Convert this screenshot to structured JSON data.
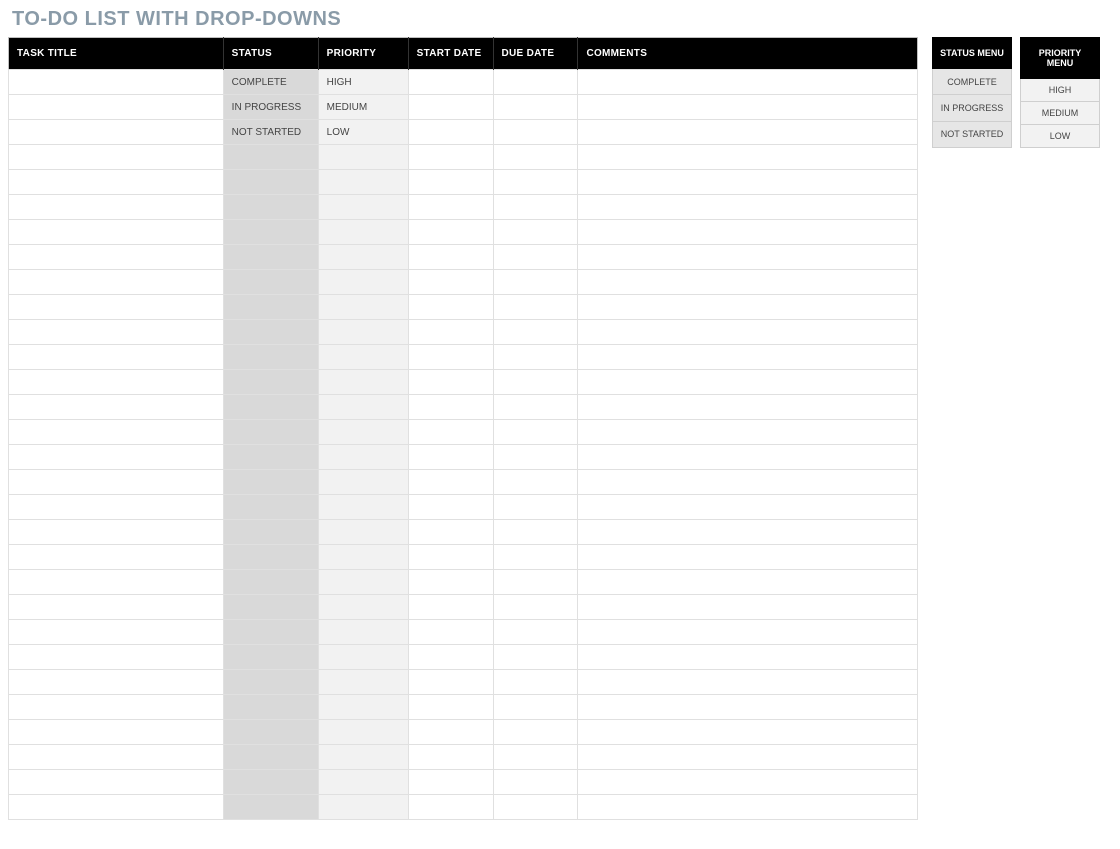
{
  "title": "TO-DO LIST WITH DROP-DOWNS",
  "columns": {
    "task": "TASK TITLE",
    "status": "STATUS",
    "priority": "PRIORITY",
    "start": "START DATE",
    "due": "DUE DATE",
    "comments": "COMMENTS"
  },
  "rows": [
    {
      "task": "",
      "status": "COMPLETE",
      "priority": "HIGH",
      "start": "",
      "due": "",
      "comments": ""
    },
    {
      "task": "",
      "status": "IN PROGRESS",
      "priority": "MEDIUM",
      "start": "",
      "due": "",
      "comments": ""
    },
    {
      "task": "",
      "status": "NOT STARTED",
      "priority": "LOW",
      "start": "",
      "due": "",
      "comments": ""
    },
    {
      "task": "",
      "status": "",
      "priority": "",
      "start": "",
      "due": "",
      "comments": ""
    },
    {
      "task": "",
      "status": "",
      "priority": "",
      "start": "",
      "due": "",
      "comments": ""
    },
    {
      "task": "",
      "status": "",
      "priority": "",
      "start": "",
      "due": "",
      "comments": ""
    },
    {
      "task": "",
      "status": "",
      "priority": "",
      "start": "",
      "due": "",
      "comments": ""
    },
    {
      "task": "",
      "status": "",
      "priority": "",
      "start": "",
      "due": "",
      "comments": ""
    },
    {
      "task": "",
      "status": "",
      "priority": "",
      "start": "",
      "due": "",
      "comments": ""
    },
    {
      "task": "",
      "status": "",
      "priority": "",
      "start": "",
      "due": "",
      "comments": ""
    },
    {
      "task": "",
      "status": "",
      "priority": "",
      "start": "",
      "due": "",
      "comments": ""
    },
    {
      "task": "",
      "status": "",
      "priority": "",
      "start": "",
      "due": "",
      "comments": ""
    },
    {
      "task": "",
      "status": "",
      "priority": "",
      "start": "",
      "due": "",
      "comments": ""
    },
    {
      "task": "",
      "status": "",
      "priority": "",
      "start": "",
      "due": "",
      "comments": ""
    },
    {
      "task": "",
      "status": "",
      "priority": "",
      "start": "",
      "due": "",
      "comments": ""
    },
    {
      "task": "",
      "status": "",
      "priority": "",
      "start": "",
      "due": "",
      "comments": ""
    },
    {
      "task": "",
      "status": "",
      "priority": "",
      "start": "",
      "due": "",
      "comments": ""
    },
    {
      "task": "",
      "status": "",
      "priority": "",
      "start": "",
      "due": "",
      "comments": ""
    },
    {
      "task": "",
      "status": "",
      "priority": "",
      "start": "",
      "due": "",
      "comments": ""
    },
    {
      "task": "",
      "status": "",
      "priority": "",
      "start": "",
      "due": "",
      "comments": ""
    },
    {
      "task": "",
      "status": "",
      "priority": "",
      "start": "",
      "due": "",
      "comments": ""
    },
    {
      "task": "",
      "status": "",
      "priority": "",
      "start": "",
      "due": "",
      "comments": ""
    },
    {
      "task": "",
      "status": "",
      "priority": "",
      "start": "",
      "due": "",
      "comments": ""
    },
    {
      "task": "",
      "status": "",
      "priority": "",
      "start": "",
      "due": "",
      "comments": ""
    },
    {
      "task": "",
      "status": "",
      "priority": "",
      "start": "",
      "due": "",
      "comments": ""
    },
    {
      "task": "",
      "status": "",
      "priority": "",
      "start": "",
      "due": "",
      "comments": ""
    },
    {
      "task": "",
      "status": "",
      "priority": "",
      "start": "",
      "due": "",
      "comments": ""
    },
    {
      "task": "",
      "status": "",
      "priority": "",
      "start": "",
      "due": "",
      "comments": ""
    },
    {
      "task": "",
      "status": "",
      "priority": "",
      "start": "",
      "due": "",
      "comments": ""
    },
    {
      "task": "",
      "status": "",
      "priority": "",
      "start": "",
      "due": "",
      "comments": ""
    }
  ],
  "status_menu": {
    "header": "STATUS MENU",
    "items": [
      "COMPLETE",
      "IN PROGRESS",
      "NOT STARTED"
    ]
  },
  "priority_menu": {
    "header": "PRIORITY MENU",
    "items": [
      "HIGH",
      "MEDIUM",
      "LOW"
    ]
  }
}
